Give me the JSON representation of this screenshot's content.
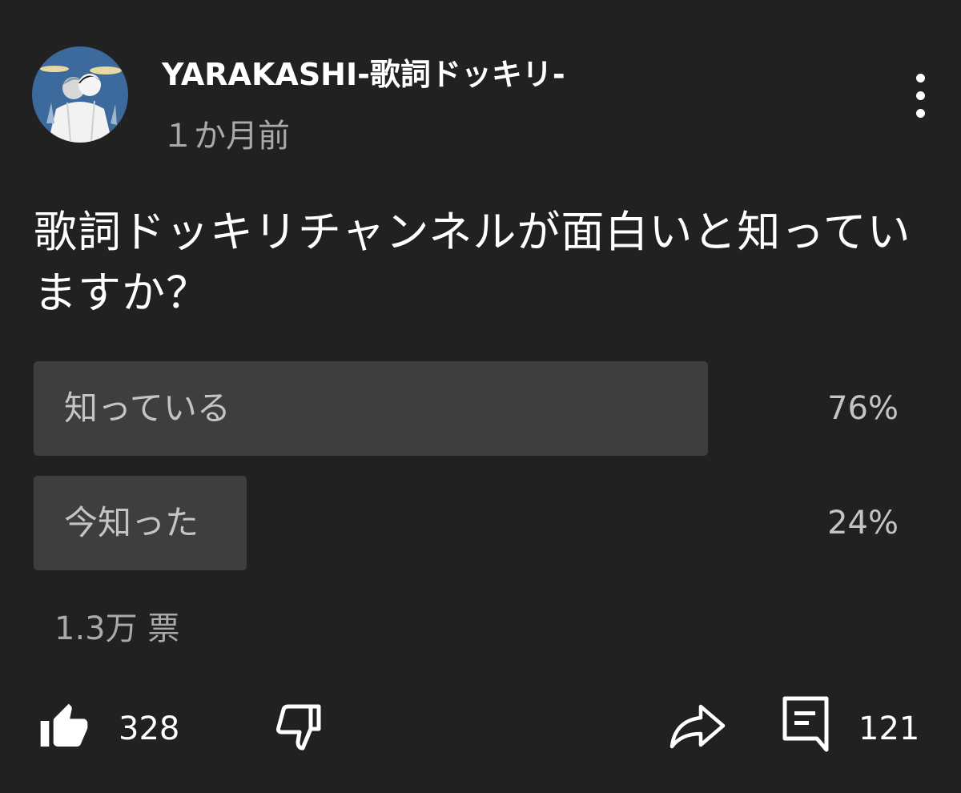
{
  "header": {
    "channel_name": "YARAKASHI-歌詞ドッキリ-",
    "timestamp": "１か月前",
    "menu_icon": "more-vertical-icon"
  },
  "poll": {
    "question": "歌詞ドッキリチャンネルが面白いと知っていますか？",
    "options": [
      {
        "label": "知っている",
        "percent_text": "76%",
        "percent": 76
      },
      {
        "label": "今知った",
        "percent_text": "24%",
        "percent": 24
      }
    ],
    "vote_count": "1.3万 票"
  },
  "actions": {
    "like_icon": "thumbs-up-icon",
    "like_count": "328",
    "dislike_icon": "thumbs-down-icon",
    "share_icon": "share-icon",
    "comment_icon": "comment-icon",
    "comment_count": "121"
  },
  "colors": {
    "background": "#212121",
    "bar": "#3e3e3e",
    "secondary_text": "#aaaaaa"
  }
}
